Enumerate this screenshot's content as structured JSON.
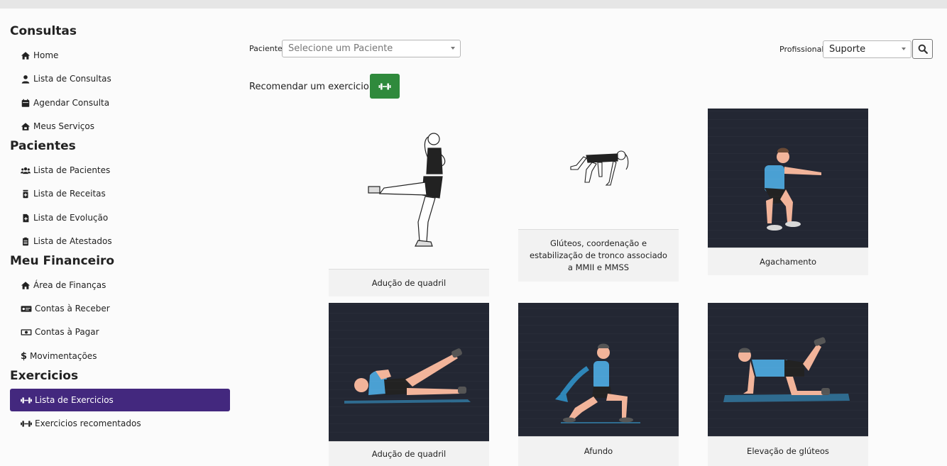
{
  "sidebar": {
    "sections": [
      {
        "title": "Consultas",
        "items": [
          {
            "label": "Home",
            "icon": "home-icon"
          },
          {
            "label": "Lista de Consultas",
            "icon": "user-doctor-icon"
          },
          {
            "label": "Agendar Consulta",
            "icon": "calendar-icon"
          },
          {
            "label": "Meus Serviços",
            "icon": "house-service-icon"
          }
        ]
      },
      {
        "title": "Pacientes",
        "items": [
          {
            "label": "Lista de Pacientes",
            "icon": "users-icon"
          },
          {
            "label": "Lista de Receitas",
            "icon": "prescription-icon"
          },
          {
            "label": "Lista de Evolução",
            "icon": "file-plus-icon"
          },
          {
            "label": "Lista de Atestados",
            "icon": "clipboard-icon"
          }
        ]
      },
      {
        "title": "Meu Financeiro",
        "items": [
          {
            "label": "Área de Finanças",
            "icon": "home-icon"
          },
          {
            "label": "Contas à Receber",
            "icon": "money-card-icon"
          },
          {
            "label": "Contas à Pagar",
            "icon": "money-bill-icon"
          },
          {
            "label": "Movimentações",
            "icon": "dollar-icon"
          }
        ]
      },
      {
        "title": "Exercicios",
        "items": [
          {
            "label": "Lista de Exercicios",
            "icon": "dumbbell-icon",
            "active": true
          },
          {
            "label": "Exercicios recomentados",
            "icon": "dumbbell-icon"
          }
        ]
      }
    ]
  },
  "filters": {
    "patient_label": "Paciente",
    "patient_placeholder": "Selecione um Paciente",
    "professional_label": "Profissional",
    "professional_value": "Suporte",
    "search_icon": "search-icon"
  },
  "recommend": {
    "label": "Recomendar um exercicio:",
    "button_icon": "dumbbell-icon",
    "button_color": "#2f8a3c"
  },
  "exercises": [
    {
      "caption": "Adução de quadril",
      "image": "standing-hip-adduction",
      "style": "light"
    },
    {
      "caption": "Glúteos, coordenação e estabilização de tronco associado a MMII e MMSS",
      "image": "bird-dog",
      "style": "light"
    },
    {
      "caption": "Agachamento",
      "image": "squat",
      "style": "dark"
    },
    {
      "caption": "Adução de quadril",
      "image": "side-lying-leg-raise",
      "style": "dark"
    },
    {
      "caption": "Afundo",
      "image": "lunge",
      "style": "dark"
    },
    {
      "caption": "Elevação de glúteos",
      "image": "donkey-kick",
      "style": "dark"
    }
  ],
  "colors": {
    "active_nav": "#43287e",
    "accent_green": "#2f8a3c",
    "card_dark": "#232733"
  }
}
